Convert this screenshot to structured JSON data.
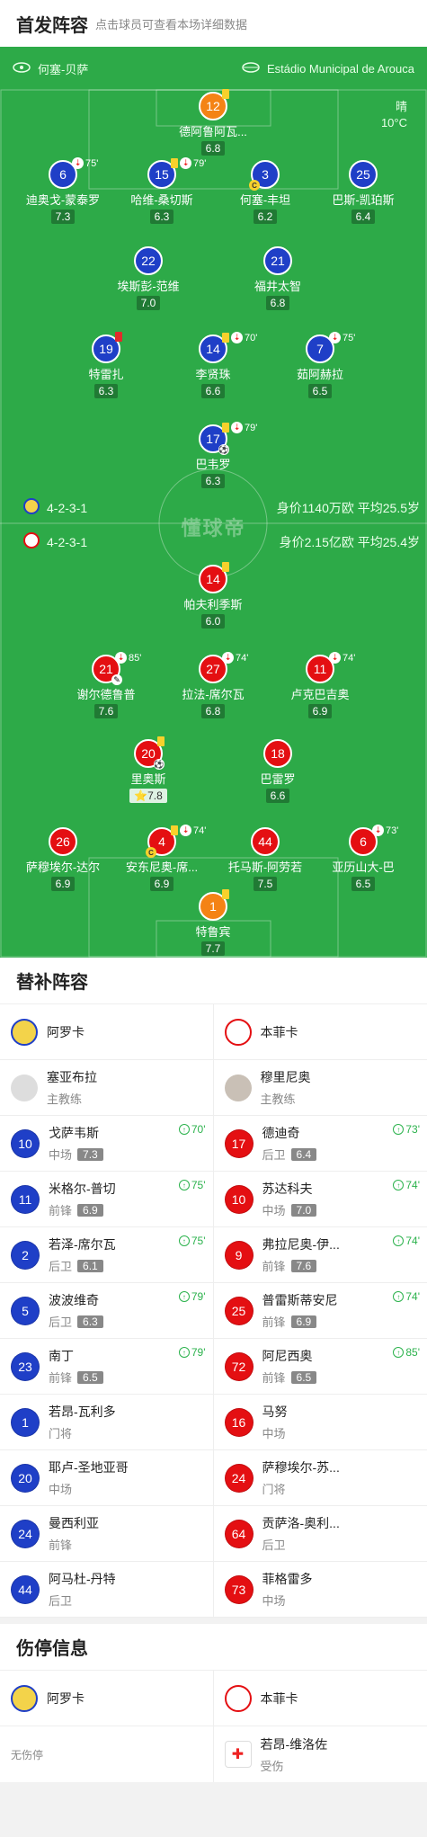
{
  "header": {
    "title": "首发阵容",
    "subtitle": "点击球员可查看本场详细数据"
  },
  "pitch": {
    "home_team": "何塞-贝萨",
    "stadium": "Estádio Municipal de Arouca",
    "weather": "晴",
    "temperature": "10°C",
    "watermark": "懂球帝",
    "home_formation": "4-2-3-1",
    "home_worth": "身价1140万欧  平均25.5岁",
    "away_formation": "4-2-3-1",
    "away_worth": "身价2.15亿欧  平均25.4岁"
  },
  "home_players": [
    {
      "num": "12",
      "name": "德阿鲁阿瓦...",
      "rating": "6.8",
      "cards": "Y",
      "sub": ""
    },
    {
      "num": "6",
      "name": "迪奥戈-蒙泰罗",
      "rating": "7.3",
      "cards": "",
      "sub": "75'"
    },
    {
      "num": "15",
      "name": "哈维-桑切斯",
      "rating": "6.3",
      "cards": "Y",
      "sub": "79'"
    },
    {
      "num": "3",
      "name": "何塞-丰坦",
      "rating": "6.2",
      "cards": "",
      "sub": ""
    },
    {
      "num": "25",
      "name": "巴斯-凯珀斯",
      "rating": "6.4",
      "cards": "",
      "sub": ""
    },
    {
      "num": "22",
      "name": "埃斯彭-范维",
      "rating": "7.0",
      "cards": "",
      "sub": ""
    },
    {
      "num": "21",
      "name": "福井太智",
      "rating": "6.8",
      "cards": "",
      "sub": ""
    },
    {
      "num": "19",
      "name": "特雷扎",
      "rating": "6.3",
      "cards": "R",
      "sub": ""
    },
    {
      "num": "14",
      "name": "李贤珠",
      "rating": "6.6",
      "cards": "Y",
      "sub": "70'"
    },
    {
      "num": "7",
      "name": "茹阿赫拉",
      "rating": "6.5",
      "cards": "",
      "sub": "75'"
    },
    {
      "num": "17",
      "name": "巴韦罗",
      "rating": "6.3",
      "cards": "Y",
      "sub": "79'"
    }
  ],
  "away_players": [
    {
      "num": "14",
      "name": "帕夫利季斯",
      "rating": "6.0",
      "cards": "Y",
      "sub": ""
    },
    {
      "num": "21",
      "name": "谢尔德鲁普",
      "rating": "7.6",
      "cards": "",
      "sub": "85'"
    },
    {
      "num": "27",
      "name": "拉法-席尔瓦",
      "rating": "6.8",
      "cards": "",
      "sub": "74'"
    },
    {
      "num": "11",
      "name": "卢克巴吉奥",
      "rating": "6.9",
      "cards": "",
      "sub": "74'"
    },
    {
      "num": "20",
      "name": "里奥斯",
      "rating": "7.8",
      "cards": "Y",
      "sub": ""
    },
    {
      "num": "18",
      "name": "巴雷罗",
      "rating": "6.6",
      "cards": "",
      "sub": ""
    },
    {
      "num": "26",
      "name": "萨穆埃尔-达尔",
      "rating": "6.9",
      "cards": "",
      "sub": ""
    },
    {
      "num": "4",
      "name": "安东尼奥-席...",
      "rating": "6.9",
      "cards": "Y",
      "sub": "74'"
    },
    {
      "num": "44",
      "name": "托马斯-阿劳若",
      "rating": "7.5",
      "cards": "",
      "sub": ""
    },
    {
      "num": "6",
      "name": "亚历山大-巴",
      "rating": "6.5",
      "cards": "",
      "sub": "73'"
    },
    {
      "num": "1",
      "name": "特鲁宾",
      "rating": "7.7",
      "cards": "Y",
      "sub": ""
    }
  ],
  "subs": {
    "title": "替补阵容",
    "left_team": "阿罗卡",
    "right_team": "本菲卡",
    "left_coach": {
      "name": "塞亚布拉",
      "role": "主教练"
    },
    "right_coach": {
      "name": "穆里尼奥",
      "role": "主教练"
    },
    "left": [
      {
        "num": "10",
        "name": "戈萨韦斯",
        "pos": "中场",
        "rating": "7.3",
        "event": "70'"
      },
      {
        "num": "11",
        "name": "米格尔-普切",
        "pos": "前锋",
        "rating": "6.9",
        "event": "75'"
      },
      {
        "num": "2",
        "name": "若泽-席尔瓦",
        "pos": "后卫",
        "rating": "6.1",
        "event": "75'"
      },
      {
        "num": "5",
        "name": "波波维奇",
        "pos": "后卫",
        "rating": "6.3",
        "event": "79'"
      },
      {
        "num": "23",
        "name": "南丁",
        "pos": "前锋",
        "rating": "6.5",
        "event": "79'"
      },
      {
        "num": "1",
        "name": "若昂-瓦利多",
        "pos": "门将",
        "rating": "",
        "event": ""
      },
      {
        "num": "20",
        "name": "耶卢-圣地亚哥",
        "pos": "中场",
        "rating": "",
        "event": ""
      },
      {
        "num": "24",
        "name": "曼西利亚",
        "pos": "前锋",
        "rating": "",
        "event": ""
      },
      {
        "num": "44",
        "name": "阿马杜-丹特",
        "pos": "后卫",
        "rating": "",
        "event": ""
      }
    ],
    "right": [
      {
        "num": "17",
        "name": "德迪奇",
        "pos": "后卫",
        "rating": "6.4",
        "event": "73'"
      },
      {
        "num": "10",
        "name": "苏达科夫",
        "pos": "中场",
        "rating": "7.0",
        "event": "74'"
      },
      {
        "num": "9",
        "name": "弗拉尼奥-伊...",
        "pos": "前锋",
        "rating": "7.6",
        "event": "74'"
      },
      {
        "num": "25",
        "name": "普雷斯蒂安尼",
        "pos": "前锋",
        "rating": "6.9",
        "event": "74'"
      },
      {
        "num": "72",
        "name": "阿尼西奥",
        "pos": "前锋",
        "rating": "6.5",
        "event": "85'"
      },
      {
        "num": "16",
        "name": "马努",
        "pos": "中场",
        "rating": "",
        "event": ""
      },
      {
        "num": "24",
        "name": "萨穆埃尔-苏...",
        "pos": "门将",
        "rating": "",
        "event": ""
      },
      {
        "num": "64",
        "name": "贡萨洛-奥利...",
        "pos": "后卫",
        "rating": "",
        "event": ""
      },
      {
        "num": "73",
        "name": "菲格雷多",
        "pos": "中场",
        "rating": "",
        "event": ""
      }
    ]
  },
  "injuries": {
    "title": "伤停信息",
    "left_team": "阿罗卡",
    "right_team": "本菲卡",
    "left_none": "无伤停",
    "right_player": "若昂-维洛佐",
    "right_status": "受伤"
  },
  "colors": {
    "home": "#1f3fc7",
    "away": "#e40f12",
    "keeper_home": "#f48315",
    "pitch": "#2daa48"
  }
}
